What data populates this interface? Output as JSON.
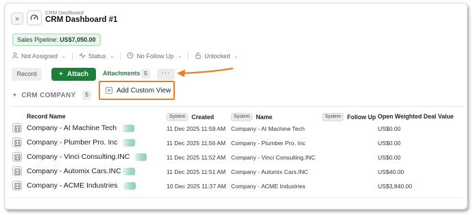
{
  "header": {
    "breadcrumb": "CRM Dashboard",
    "title": "CRM Dashboard #1",
    "expand_icon": "»",
    "app_icon": "gauge-icon"
  },
  "pipeline": {
    "label": "Sales Pipeline:",
    "value": "US$7,050.00"
  },
  "filters": [
    {
      "label": "Not Assigned",
      "icon": "user-icon"
    },
    {
      "label": "Status",
      "icon": "activity-icon"
    },
    {
      "label": "No Follow Up",
      "icon": "clock-icon"
    },
    {
      "label": "Unlocked",
      "icon": "unlock-icon"
    }
  ],
  "tabs": {
    "record": "Record",
    "attach": "Attach",
    "attach_plus": "+",
    "attachments": "Attachments",
    "attachments_count": "5",
    "more": "···"
  },
  "custom_view": {
    "label": "Add Custom View",
    "plus": "+"
  },
  "section": {
    "title": "CRM COMPANY",
    "count": "5",
    "caret": "▼"
  },
  "columns": {
    "record_name": "Record Name",
    "system_tag": "System",
    "created": "Created",
    "name": "Name",
    "follow_up": "Follow Up",
    "deal_value": "Open Weighted Deal Value"
  },
  "rows": [
    {
      "record_name": "Company - AI Machine Tech",
      "created": "11 Dec 2025 11:59 AM",
      "name": "Company - AI Machine Tech",
      "deal_value": "US$0.00"
    },
    {
      "record_name": "Company - Plumber Pro. Inc",
      "created": "11 Dec 2025 11:56 AM",
      "name": "Company - Plumber Pro. Inc",
      "deal_value": "US$0.00"
    },
    {
      "record_name": "Company - Vinci Consulting.INC",
      "created": "11 Dec 2025 11:52 AM",
      "name": "Company - Vinci Consulting.INC",
      "deal_value": "US$0.00"
    },
    {
      "record_name": "Company - Automix Cars.INC",
      "created": "11 Dec 2025 11:51 AM",
      "name": "Company - Automix Cars.INC",
      "deal_value": "US$40.00"
    },
    {
      "record_name": "Company - ACME Industries",
      "created": "10 Dec 2025 11:37 AM",
      "name": "Company - ACME Industries",
      "deal_value": "US$3,840.00"
    }
  ],
  "colors": {
    "accent_green": "#1a7f37",
    "highlight_orange": "#f07c1f"
  }
}
